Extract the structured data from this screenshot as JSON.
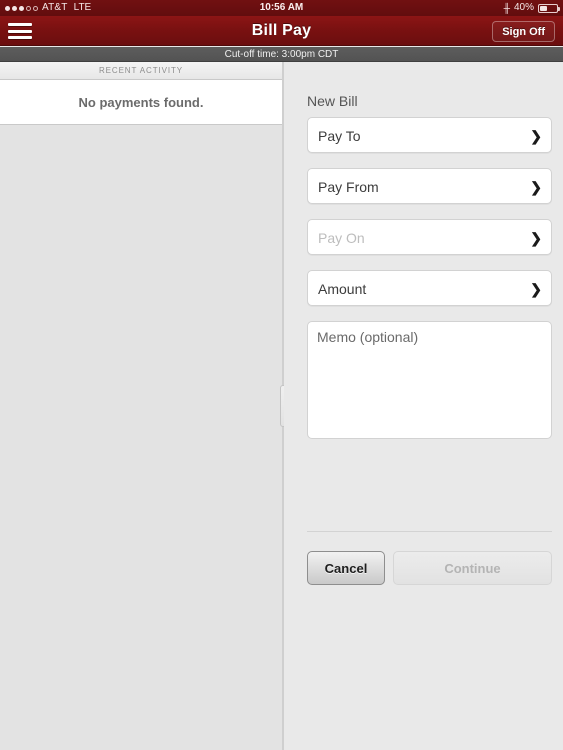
{
  "status_bar": {
    "signal_filled": 3,
    "signal_hollow": 2,
    "carrier": "AT&T",
    "network": "LTE",
    "time": "10:56 AM",
    "bluetooth_icon": "bluetooth-icon",
    "battery_percent": "40%",
    "battery_level": 40
  },
  "navbar": {
    "menu_icon": "hamburger-menu-icon",
    "title": "Bill Pay",
    "sign_off_label": "Sign Off",
    "background_color": "#7a1111"
  },
  "cutoff_banner": {
    "text": "Cut-off time: 3:00pm CDT"
  },
  "master_pane": {
    "section_header": "RECENT ACTIVITY",
    "empty_message": "No payments found."
  },
  "splitter": {
    "handle_icon": "drag-handle-icon"
  },
  "detail_pane": {
    "form_title": "New Bill",
    "fields": [
      {
        "label": "Pay To",
        "state": "enabled",
        "chevron": "chevron-right-icon"
      },
      {
        "label": "Pay From",
        "state": "enabled",
        "chevron": "chevron-right-icon"
      },
      {
        "label": "Pay On",
        "state": "disabled",
        "chevron": "chevron-right-icon"
      },
      {
        "label": "Amount",
        "state": "enabled",
        "chevron": "chevron-right-icon"
      }
    ],
    "memo_placeholder": "Memo (optional)",
    "memo_value": "",
    "buttons": {
      "cancel_label": "Cancel",
      "continue_label": "Continue",
      "continue_state": "disabled"
    }
  }
}
